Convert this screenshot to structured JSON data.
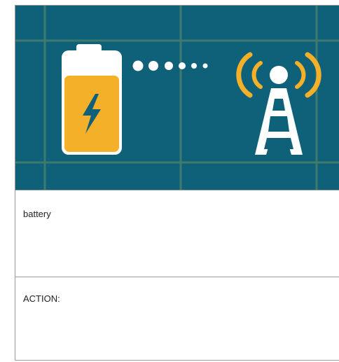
{
  "image": {
    "description_icon": "battery-to-cell-tower-icon",
    "colors": {
      "background": "#0f6179",
      "grid": "#3f7a6f",
      "battery_body": "#ffffff",
      "battery_fill": "#f5b029",
      "bolt": "#0f6179",
      "dots": "#ffffff",
      "waves": "#f5b029",
      "tower": "#ffffff"
    }
  },
  "caption": {
    "text": "battery"
  },
  "action": {
    "label": "ACTION:"
  }
}
